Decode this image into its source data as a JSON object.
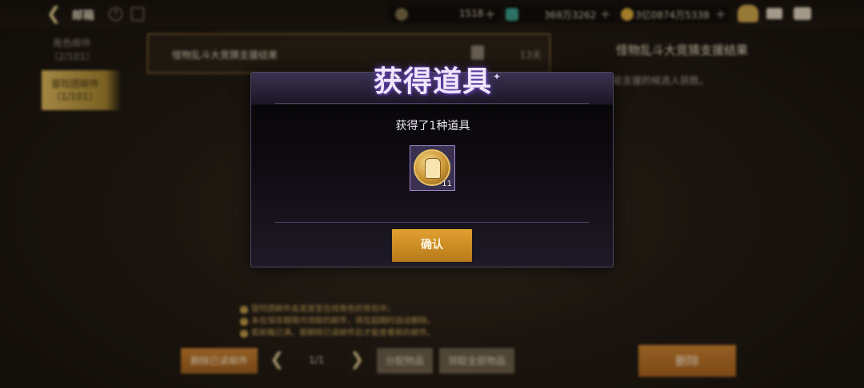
{
  "topbar": {
    "title": "邮箱",
    "help_glyph": "?",
    "currencies": [
      {
        "icon": "coin-c-icon",
        "value": "1518"
      },
      {
        "icon": "gem-icon",
        "value": "369万3262"
      },
      {
        "icon": "gold-coin-icon",
        "value": "3亿0874万5338"
      }
    ]
  },
  "tabs": [
    {
      "label": "角色邮件",
      "count": "（2/101）"
    },
    {
      "label": "冒险团邮件",
      "count": "（1/101）"
    }
  ],
  "mail_list": [
    {
      "title": "怪物乱斗大竞猜支援结果",
      "days": "13天"
    }
  ],
  "detail": {
    "title": "怪物乱斗大竞猜支援结果",
    "body": "能支援的候选人获胜。"
  },
  "notes": [
    "冒险团邮件会发放至在线角色的背包中。",
    "未在保存期限内领取的邮件，将在超期时自动删除。",
    "若邮箱已满，需删除已读邮件后才能查看新的邮件。"
  ],
  "bottom": {
    "delete_read": "删除已读邮件",
    "page": "1/1",
    "distribute": "分配物品",
    "claim_all": "领取全部物品",
    "delete": "删除"
  },
  "modal": {
    "heading": "获得道具",
    "subtitle": "获得了1种道具",
    "item_count": "11",
    "confirm": "确认"
  },
  "colors": {
    "accent_gold": "#c9a24a",
    "button_orange": "#c77f2e",
    "modal_purple": "#a48ad4"
  }
}
